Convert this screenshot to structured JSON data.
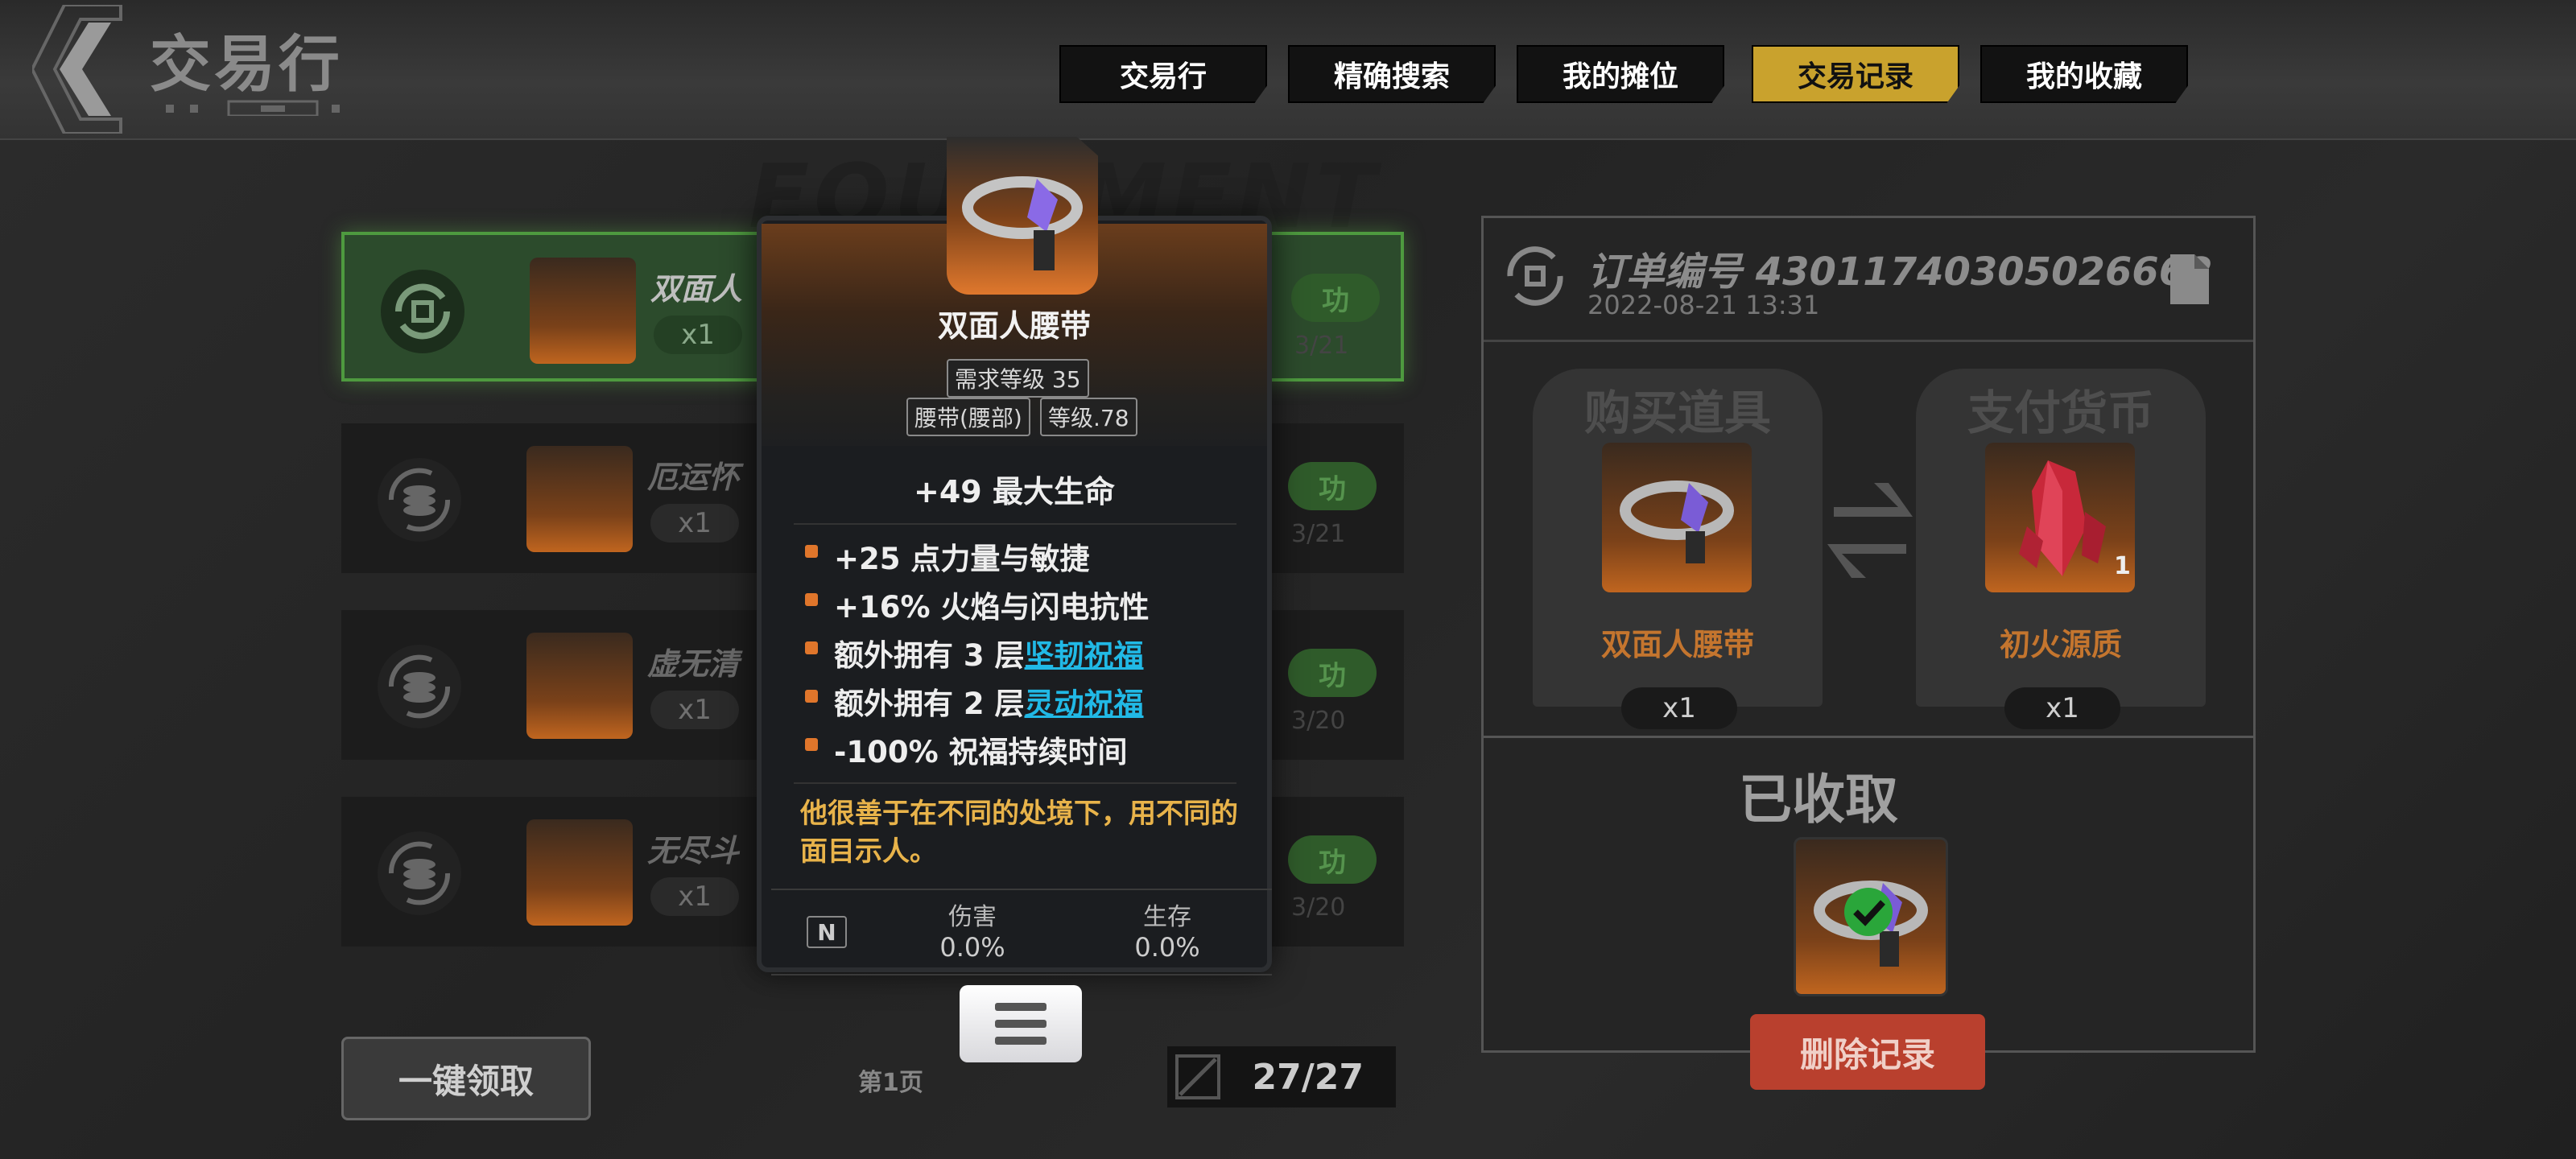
{
  "header": {
    "title": "交易行",
    "tabs": [
      {
        "label": "交易行",
        "active": false
      },
      {
        "label": "精确搜索",
        "active": false
      },
      {
        "label": "我的摊位",
        "active": false
      },
      {
        "label": "交易记录",
        "active": true
      },
      {
        "label": "我的收藏",
        "active": false
      }
    ],
    "watermark": "EQUIPMENT"
  },
  "records": [
    {
      "name": "双面人",
      "qty": "x1",
      "status": "功",
      "date": "3/21",
      "selected": true,
      "icon": "refresh-icon"
    },
    {
      "name": "厄运怀",
      "qty": "x1",
      "status": "功",
      "date": "3/21",
      "selected": false,
      "icon": "coin-stack-icon"
    },
    {
      "name": "虚无清",
      "qty": "x1",
      "status": "功",
      "date": "3/20",
      "selected": false,
      "icon": "coin-stack-icon"
    },
    {
      "name": "无尽斗",
      "qty": "x1",
      "status": "功",
      "date": "3/20",
      "selected": false,
      "icon": "coin-stack-icon"
    }
  ],
  "footer": {
    "claim_all": "一键领取",
    "page_label": "第1页",
    "page_count": "27/27"
  },
  "order": {
    "number": "订单编号 43011740305026662",
    "time": "2022-08-21 13:31",
    "buy_title": "购买道具",
    "buy_item": "双面人腰带",
    "buy_qty": "x1",
    "pay_title": "支付货币",
    "pay_item": "初火源质",
    "pay_qty": "x1",
    "pay_badge": "1",
    "received": "已收取",
    "delete": "删除记录"
  },
  "tooltip": {
    "name": "双面人腰带",
    "req": "需求等级 35",
    "slot": "腰带(腰部)",
    "level": "等级.78",
    "base": "+49 最大生命",
    "affixes": [
      {
        "pre": "+25 点力量与敏捷",
        "link": ""
      },
      {
        "pre": "+16% 火焰与闪电抗性",
        "link": ""
      },
      {
        "pre": "额外拥有 3 层",
        "link": "坚韧祝福"
      },
      {
        "pre": "额外拥有 2 层",
        "link": "灵动祝福"
      },
      {
        "pre": "-100% 祝福持续时间",
        "link": ""
      }
    ],
    "flavor": "他很善于在不同的处境下，用不同的面目示人。",
    "n_label": "N",
    "dmg_label": "伤害",
    "dmg_value": "0.0%",
    "surv_label": "生存",
    "surv_value": "0.0%"
  },
  "colors": {
    "accent_tab": "#c9a22d",
    "status_green": "#2f5b2a",
    "delete_red": "#b9402e",
    "rarity_orange": "#e0782d",
    "link_blue": "#21b9e6",
    "flavor_gold": "#e8b34a"
  }
}
